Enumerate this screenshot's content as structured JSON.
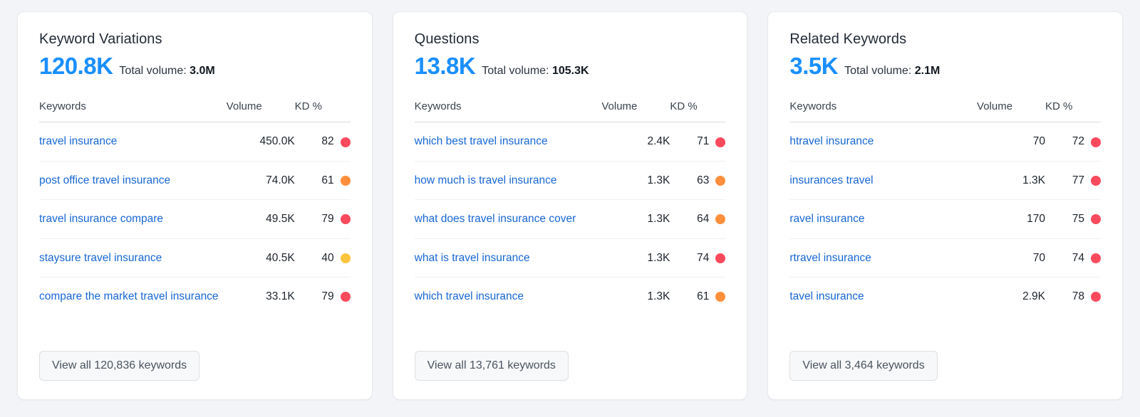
{
  "theme": {
    "page_background": "#f2f4f7",
    "card_background": "#ffffff",
    "accent_blue": "#1a8fff",
    "link_blue": "#1767d3",
    "kd_red": "#fb4a5c",
    "kd_orange": "#ff8f3c",
    "kd_yellow": "#ffc43d"
  },
  "table_headers": {
    "keywords": "Keywords",
    "volume": "Volume",
    "kd": "KD %"
  },
  "cards": [
    {
      "title": "Keyword Variations",
      "total": "120.8K",
      "volume_label": "Total volume:",
      "volume_value": "3.0M",
      "button_label": "View all 120,836 keywords",
      "rows": [
        {
          "keyword": "travel insurance",
          "volume": "450.0K",
          "kd": "82",
          "kd_color": "#fb4a5c"
        },
        {
          "keyword": "post office travel insurance",
          "volume": "74.0K",
          "kd": "61",
          "kd_color": "#ff8f3c"
        },
        {
          "keyword": "travel insurance compare",
          "volume": "49.5K",
          "kd": "79",
          "kd_color": "#fb4a5c"
        },
        {
          "keyword": "staysure travel insurance",
          "volume": "40.5K",
          "kd": "40",
          "kd_color": "#ffc43d"
        },
        {
          "keyword": "compare the market travel insurance",
          "volume": "33.1K",
          "kd": "79",
          "kd_color": "#fb4a5c"
        }
      ]
    },
    {
      "title": "Questions",
      "total": "13.8K",
      "volume_label": "Total volume:",
      "volume_value": "105.3K",
      "button_label": "View all 13,761 keywords",
      "rows": [
        {
          "keyword": "which best travel insurance",
          "volume": "2.4K",
          "kd": "71",
          "kd_color": "#fb4a5c"
        },
        {
          "keyword": "how much is travel insurance",
          "volume": "1.3K",
          "kd": "63",
          "kd_color": "#ff8f3c"
        },
        {
          "keyword": "what does travel insurance cover",
          "volume": "1.3K",
          "kd": "64",
          "kd_color": "#ff8f3c"
        },
        {
          "keyword": "what is travel insurance",
          "volume": "1.3K",
          "kd": "74",
          "kd_color": "#fb4a5c"
        },
        {
          "keyword": "which travel insurance",
          "volume": "1.3K",
          "kd": "61",
          "kd_color": "#ff8f3c"
        }
      ]
    },
    {
      "title": "Related Keywords",
      "total": "3.5K",
      "volume_label": "Total volume:",
      "volume_value": "2.1M",
      "button_label": "View all 3,464 keywords",
      "rows": [
        {
          "keyword": "htravel insurance",
          "volume": "70",
          "kd": "72",
          "kd_color": "#fb4a5c"
        },
        {
          "keyword": "insurances travel",
          "volume": "1.3K",
          "kd": "77",
          "kd_color": "#fb4a5c"
        },
        {
          "keyword": "ravel insurance",
          "volume": "170",
          "kd": "75",
          "kd_color": "#fb4a5c"
        },
        {
          "keyword": "rtravel insurance",
          "volume": "70",
          "kd": "74",
          "kd_color": "#fb4a5c"
        },
        {
          "keyword": "tavel insurance",
          "volume": "2.9K",
          "kd": "78",
          "kd_color": "#fb4a5c"
        }
      ]
    }
  ]
}
